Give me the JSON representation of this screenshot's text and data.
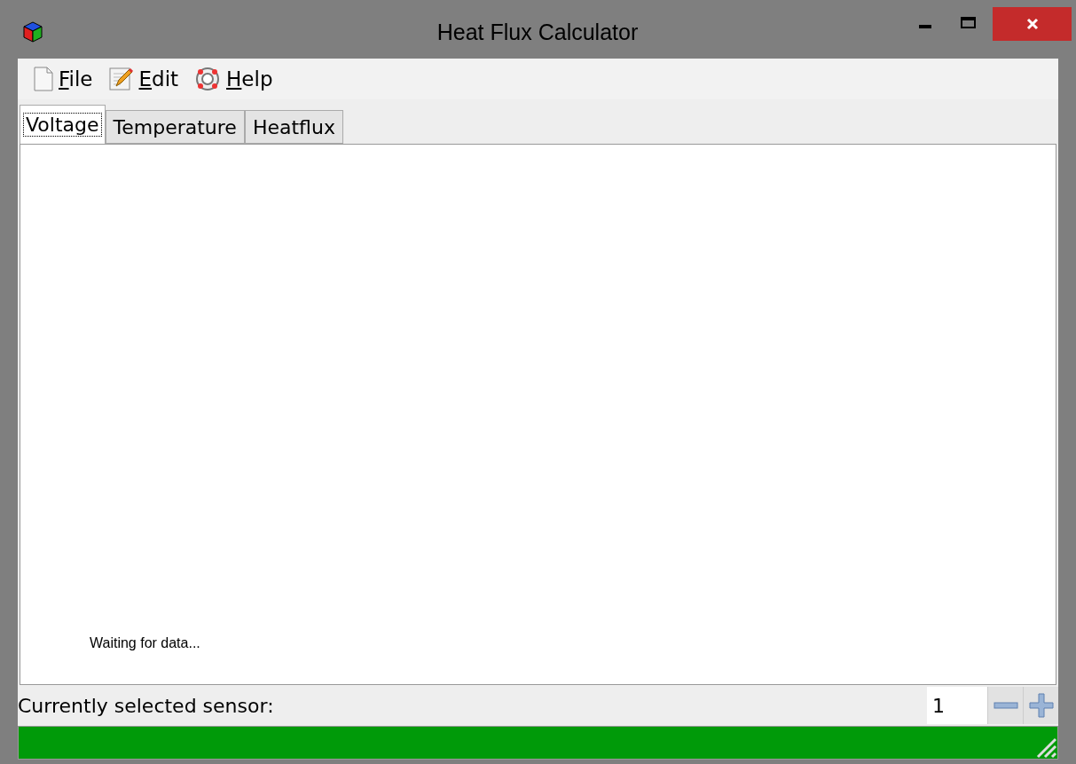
{
  "window": {
    "title": "Heat Flux Calculator"
  },
  "menu": [
    {
      "label": "File",
      "kind": "file"
    },
    {
      "label": "Edit",
      "kind": "edit"
    },
    {
      "label": "Help",
      "kind": "help"
    }
  ],
  "tabs": [
    {
      "label": "Voltage",
      "selected": true
    },
    {
      "label": "Temperature",
      "selected": false
    },
    {
      "label": "Heatflux",
      "selected": false
    }
  ],
  "panel": {
    "status": "Waiting for data..."
  },
  "sensor": {
    "label": "Currently selected sensor:",
    "value": "1"
  },
  "progress": {
    "level": 1
  }
}
